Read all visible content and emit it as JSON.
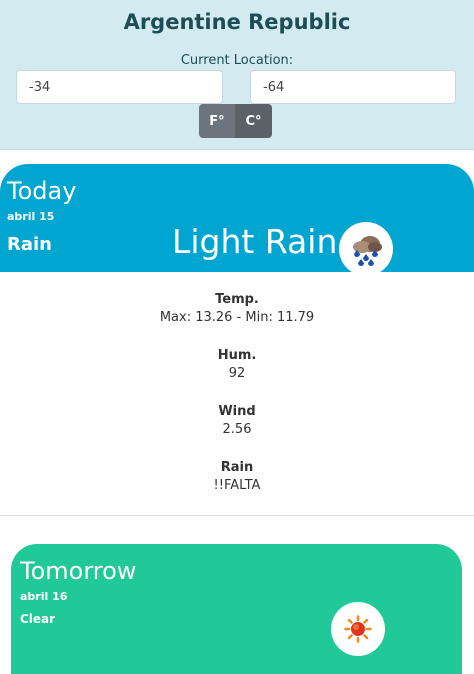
{
  "header": {
    "country": "Argentine Republic",
    "location_label": "Current Location:",
    "latitude": "-34",
    "longitude": "-64",
    "unit_f": "F°",
    "unit_c": "C°"
  },
  "today": {
    "title": "Today",
    "date": "abril 15",
    "main": "Rain",
    "description": "Light Rain",
    "icon": "rain-cloud-icon",
    "details": [
      {
        "label": "Temp.",
        "value": "Max: 13.26 - Min: 11.79"
      },
      {
        "label": "Hum.",
        "value": "92"
      },
      {
        "label": "Wind",
        "value": "2.56"
      },
      {
        "label": "Rain",
        "value": "!!FALTA"
      }
    ]
  },
  "tomorrow": {
    "title": "Tomorrow",
    "date": "abril 16",
    "main": "Clear",
    "icon": "sun-icon"
  },
  "colors": {
    "header_bg": "#d3eaf0",
    "today_bg": "#00a6d0",
    "tomorrow_bg": "#20c997"
  }
}
